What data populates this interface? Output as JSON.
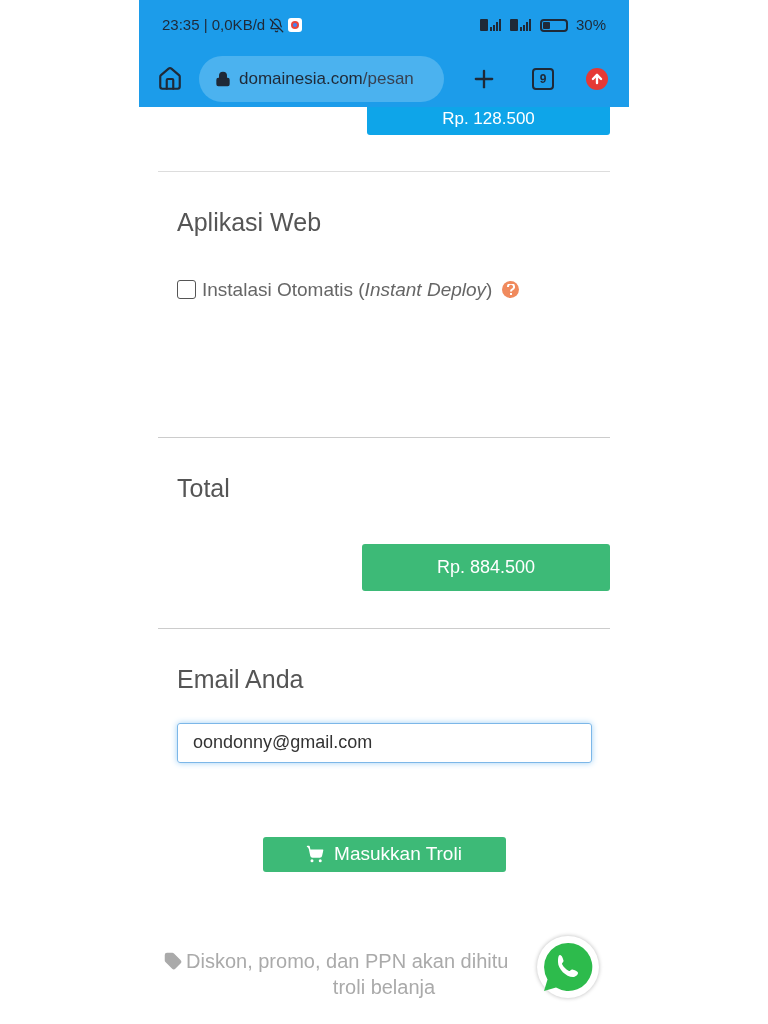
{
  "status_bar": {
    "time": "23:35 | 0,0KB/d",
    "battery": "30%"
  },
  "browser": {
    "url_domain": "domainesia.com",
    "url_path": "/pesan",
    "tab_count": "9"
  },
  "top_price": "Rp. 128.500",
  "web_app": {
    "heading": "Aplikasi Web",
    "option": {
      "label": "Instalasi Otomatis (*Instant Deploy*)",
      "checked": false
    }
  },
  "total": {
    "heading": "Total",
    "amount": "Rp. 884.500"
  },
  "email": {
    "heading": "Email Anda",
    "value": "oondonny@gmail.com"
  },
  "cart_button": "Masukkan Troli",
  "note": {
    "line_1": "Diskon, promo, dan PPN akan dihitu",
    "line_2": "troli belanja"
  }
}
